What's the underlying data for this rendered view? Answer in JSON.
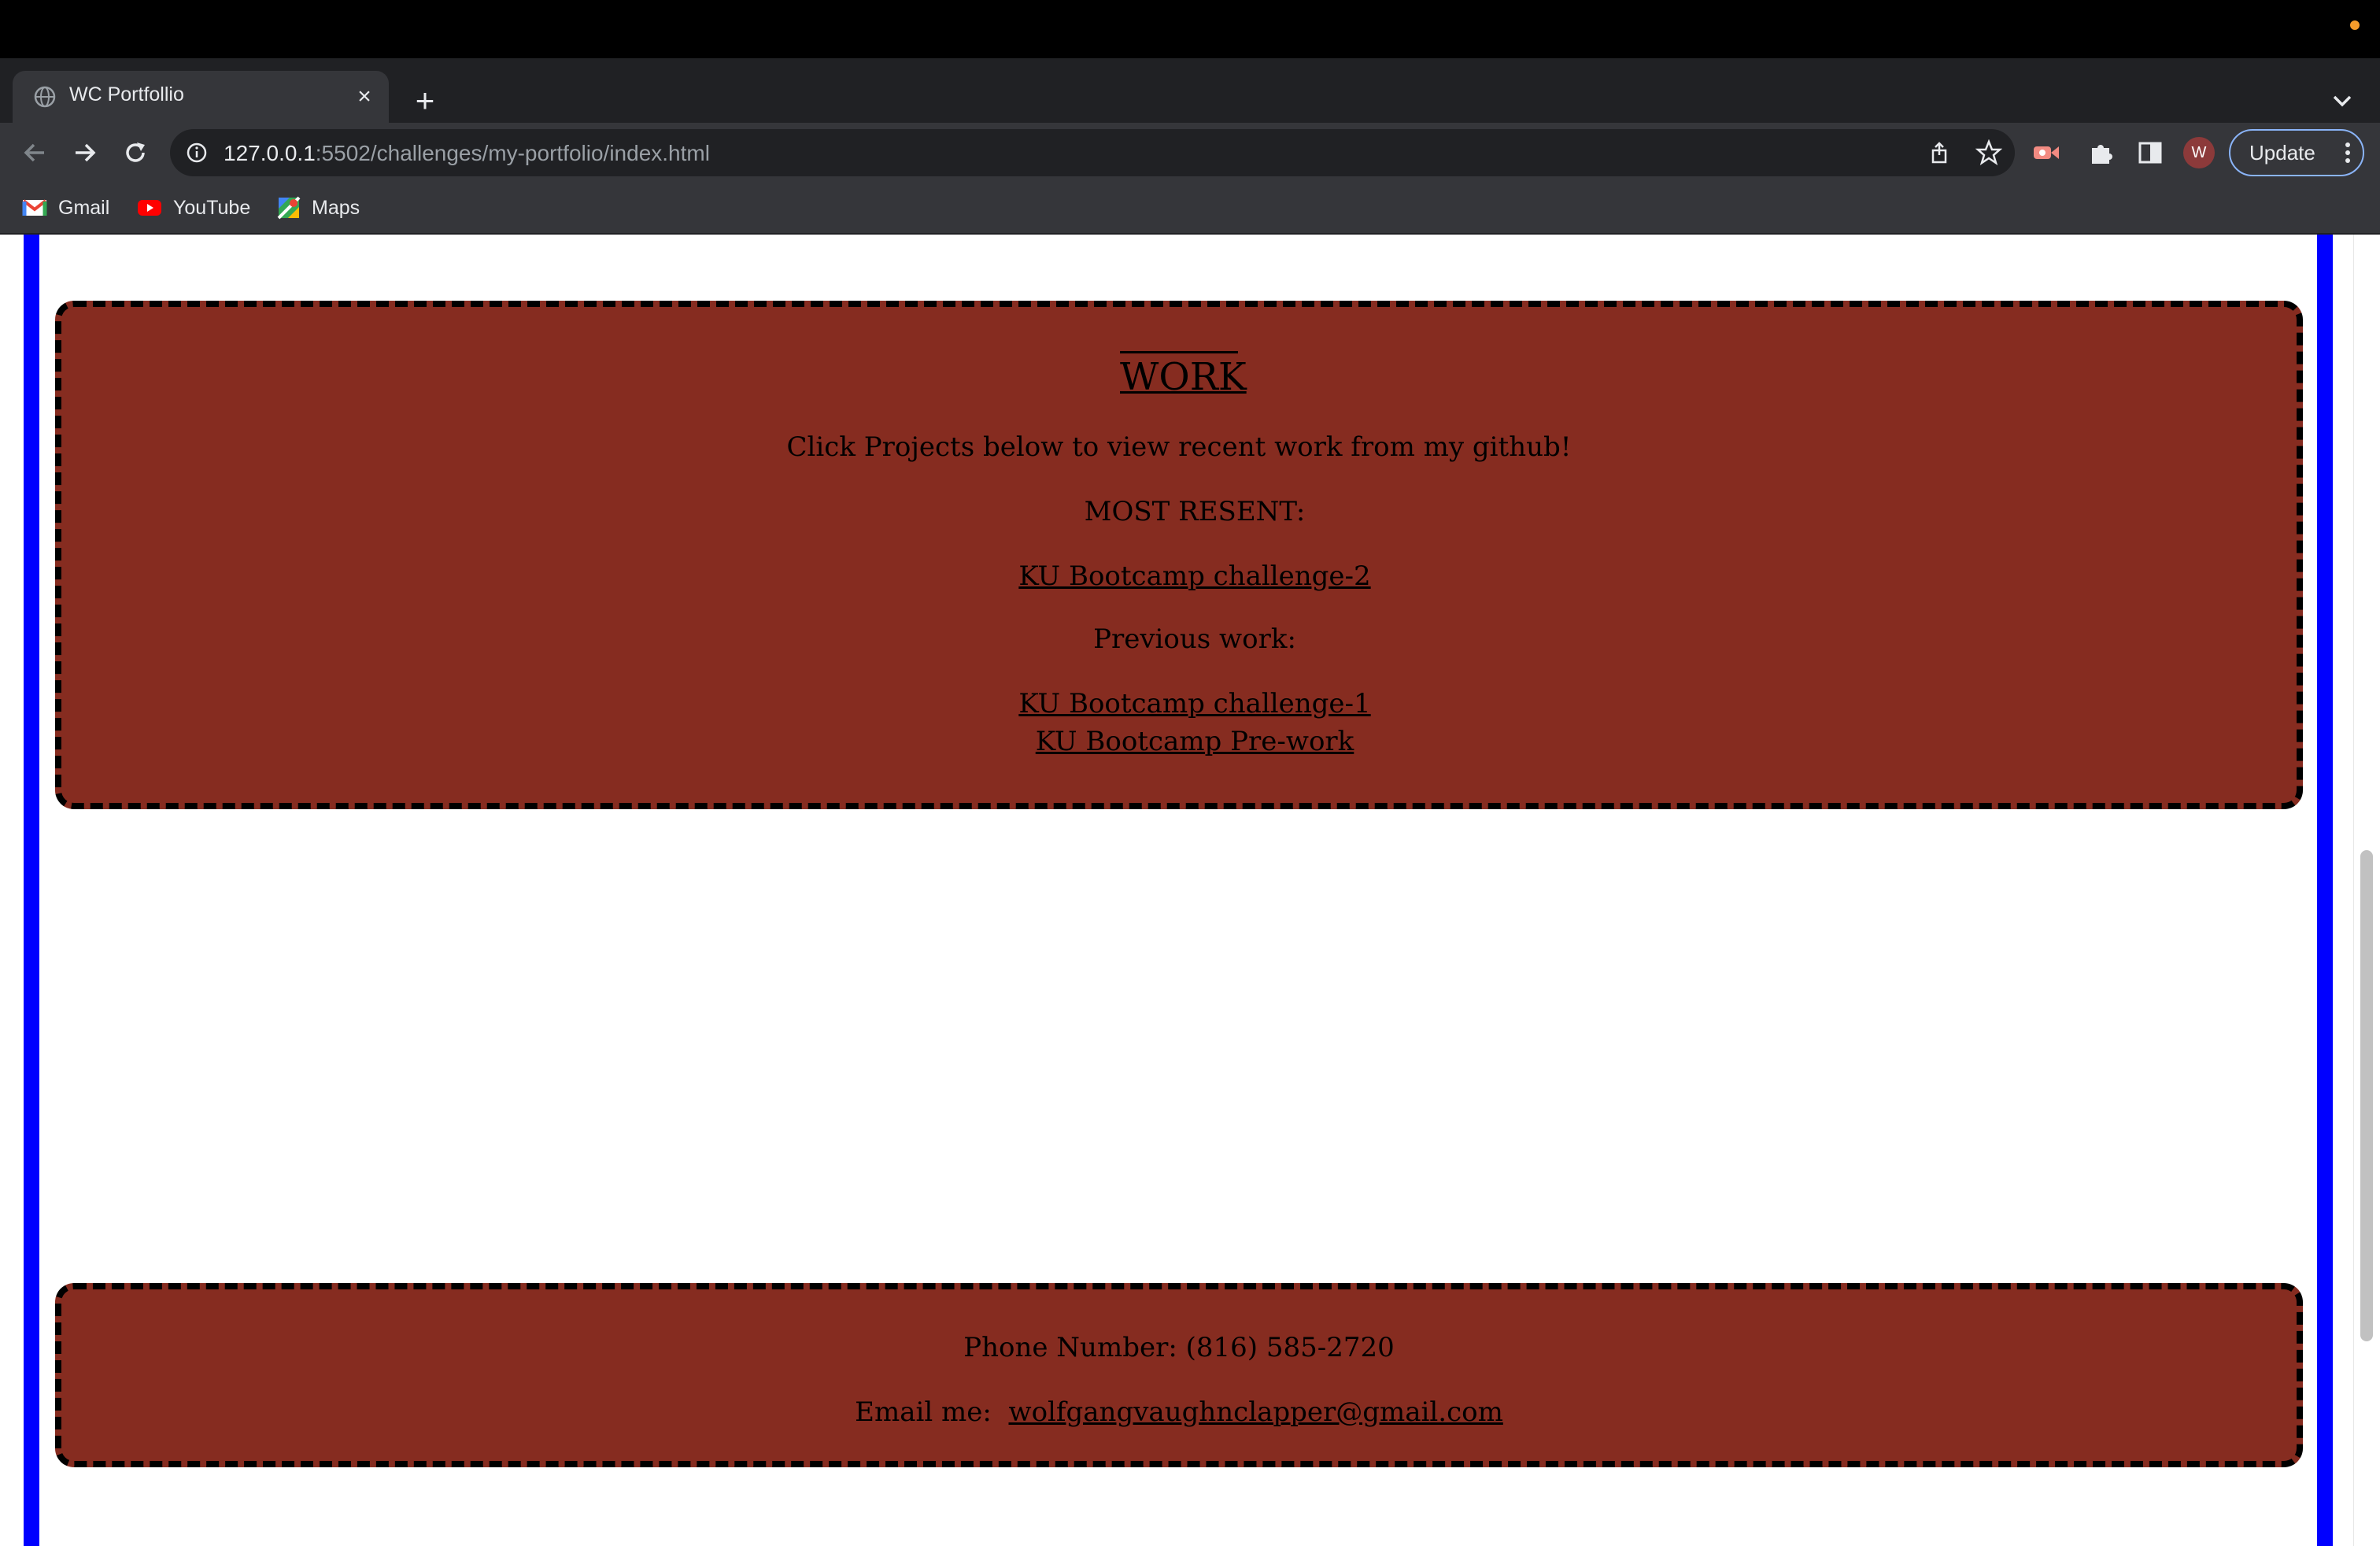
{
  "browser": {
    "tab_title": "WC Portfollio",
    "tab_close": "×",
    "new_tab": "+",
    "url_host": "127.0.0.1",
    "url_rest": ":5502/challenges/my-portfolio/index.html",
    "update_label": "Update",
    "profile_initial": "W",
    "bookmarks": [
      {
        "label": "Gmail"
      },
      {
        "label": "YouTube"
      },
      {
        "label": "Maps"
      }
    ],
    "accent_colors": {
      "rails": "#0000ff",
      "panel": "#862c20"
    }
  },
  "work": {
    "title": "WORK",
    "intro": "Click Projects below to view recent work from my github!",
    "most_recent_label": "MOST RESENT:",
    "most_recent_link": "KU Bootcamp challenge-2",
    "previous_label": "Previous work:",
    "previous_links": [
      "KU Bootcamp challenge-1",
      "KU Bootcamp Pre-work"
    ]
  },
  "contact": {
    "phone": "Phone Number: (816) 585-2720",
    "email_label": "Email me:",
    "email": "wolfgangvaughnclapper@gmail.com"
  }
}
